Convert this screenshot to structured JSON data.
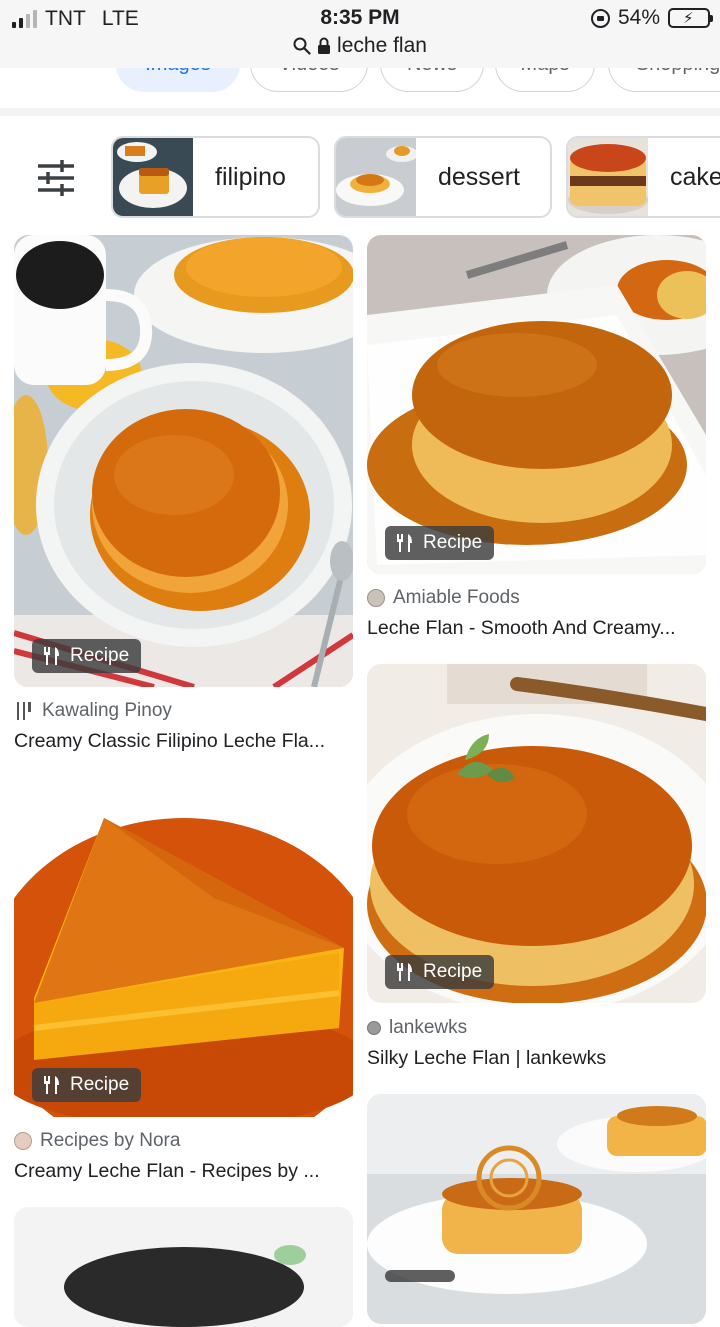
{
  "status_bar": {
    "carrier": "TNT",
    "network": "LTE",
    "time": "8:35 PM",
    "battery": "54%",
    "battery_level": 0.54,
    "url": "leche flan"
  },
  "tabs": [
    "Images",
    "Videos",
    "News",
    "Maps",
    "Shopping"
  ],
  "chips": [
    {
      "label": "filipino"
    },
    {
      "label": "dessert"
    },
    {
      "label": "cake"
    }
  ],
  "results": [
    {
      "source": "Kawaling Pinoy",
      "title": "Creamy Classic Filipino Leche Fla...",
      "badge": "Recipe"
    },
    {
      "source": "Amiable Foods",
      "title": "Leche Flan - Smooth And Creamy...",
      "badge": "Recipe"
    },
    {
      "source": "Recipes by Nora",
      "title": "Creamy Leche Flan - Recipes by ...",
      "badge": "Recipe"
    },
    {
      "source": "lankewks",
      "title": "Silky Leche Flan | lankewks",
      "badge": "Recipe"
    },
    {
      "source": "",
      "title": "",
      "badge": ""
    },
    {
      "source": "",
      "title": "",
      "badge": ""
    }
  ],
  "colors": {
    "caramel": "#c8650f",
    "flan": "#f1b23a",
    "accent": "#1a73e8"
  }
}
